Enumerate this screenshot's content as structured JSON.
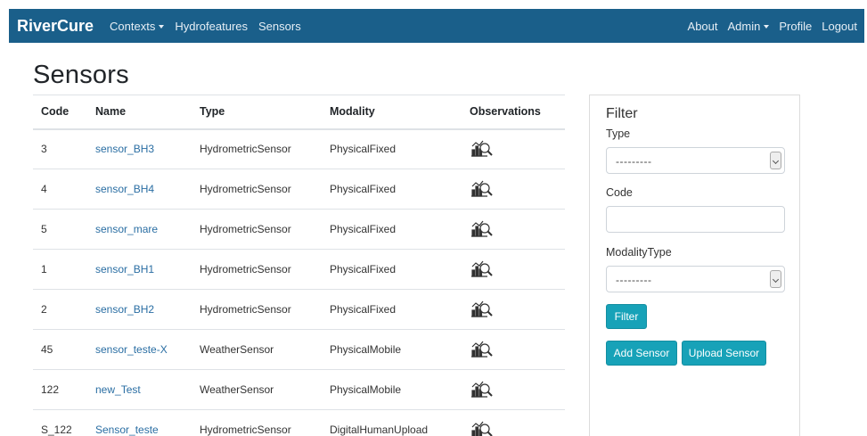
{
  "navbar": {
    "brand": "RiverCure",
    "left_items": [
      "Contexts",
      "Hydrofeatures",
      "Sensors"
    ],
    "right_items": [
      "About",
      "Admin",
      "Profile",
      "Logout"
    ]
  },
  "page_title": "Sensors",
  "table": {
    "headers": [
      "Code",
      "Name",
      "Type",
      "Modality",
      "Observations"
    ],
    "rows": [
      {
        "code": "3",
        "name": "sensor_BH3",
        "type": "HydrometricSensor",
        "modality": "PhysicalFixed"
      },
      {
        "code": "4",
        "name": "sensor_BH4",
        "type": "HydrometricSensor",
        "modality": "PhysicalFixed"
      },
      {
        "code": "5",
        "name": "sensor_mare",
        "type": "HydrometricSensor",
        "modality": "PhysicalFixed"
      },
      {
        "code": "1",
        "name": "sensor_BH1",
        "type": "HydrometricSensor",
        "modality": "PhysicalFixed"
      },
      {
        "code": "2",
        "name": "sensor_BH2",
        "type": "HydrometricSensor",
        "modality": "PhysicalFixed"
      },
      {
        "code": "45",
        "name": "sensor_teste-X",
        "type": "WeatherSensor",
        "modality": "PhysicalMobile"
      },
      {
        "code": "122",
        "name": "new_Test",
        "type": "WeatherSensor",
        "modality": "PhysicalMobile"
      },
      {
        "code": "S_122",
        "name": "Sensor_teste",
        "type": "HydrometricSensor",
        "modality": "DigitalHumanUpload"
      }
    ],
    "observations_icon": "chart-search-icon"
  },
  "filter": {
    "title": "Filter",
    "type_label": "Type",
    "type_value": "---------",
    "code_label": "Code",
    "code_value": "",
    "modality_label": "ModalityType",
    "modality_value": "---------",
    "filter_button": "Filter",
    "add_button": "Add Sensor",
    "upload_button": "Upload Sensor"
  },
  "colors": {
    "navbar": "#1a5f8a",
    "link": "#2a6ea3",
    "button": "#17a2b8"
  }
}
